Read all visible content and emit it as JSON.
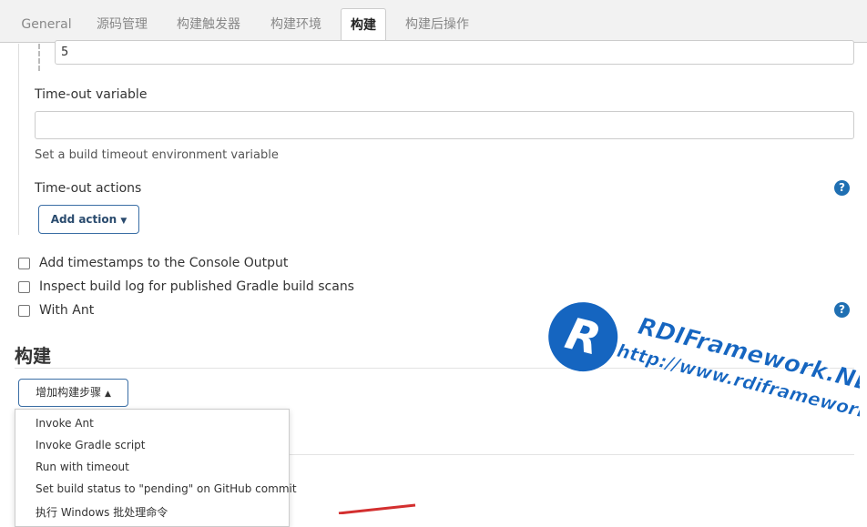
{
  "tabs": [
    "General",
    "源码管理",
    "构建触发器",
    "构建环境",
    "构建",
    "构建后操作"
  ],
  "active_tab": "构建",
  "top_field_value": "5",
  "timeout_variable": {
    "label": "Time-out variable",
    "value": "",
    "help": "Set a build timeout environment variable"
  },
  "timeout_actions": {
    "label": "Time-out actions",
    "button_label": "Add action"
  },
  "help_icon_glyph": "?",
  "checkboxes": [
    {
      "label": "Add timestamps to the Console Output",
      "checked": false
    },
    {
      "label": "Inspect build log for published Gradle build scans",
      "checked": false
    },
    {
      "label": "With Ant",
      "checked": false
    }
  ],
  "build_section": {
    "title": "构建",
    "add_step_button": "增加构建步骤"
  },
  "menu_items": [
    "Invoke Ant",
    "Invoke Gradle script",
    "Run with timeout",
    "Set build status to \"pending\" on GitHub commit",
    "执行 Windows 批处理命令"
  ],
  "watermark": {
    "logo_letter": "R",
    "name": "RDIFramework.NET",
    "url": "http://www.rdiframework.net"
  },
  "colors": {
    "help_icon": "#1f6fb2",
    "button_border": "#3a6ea5",
    "watermark_blue": "#1565c0",
    "arrow_red": "#d32f2f"
  }
}
